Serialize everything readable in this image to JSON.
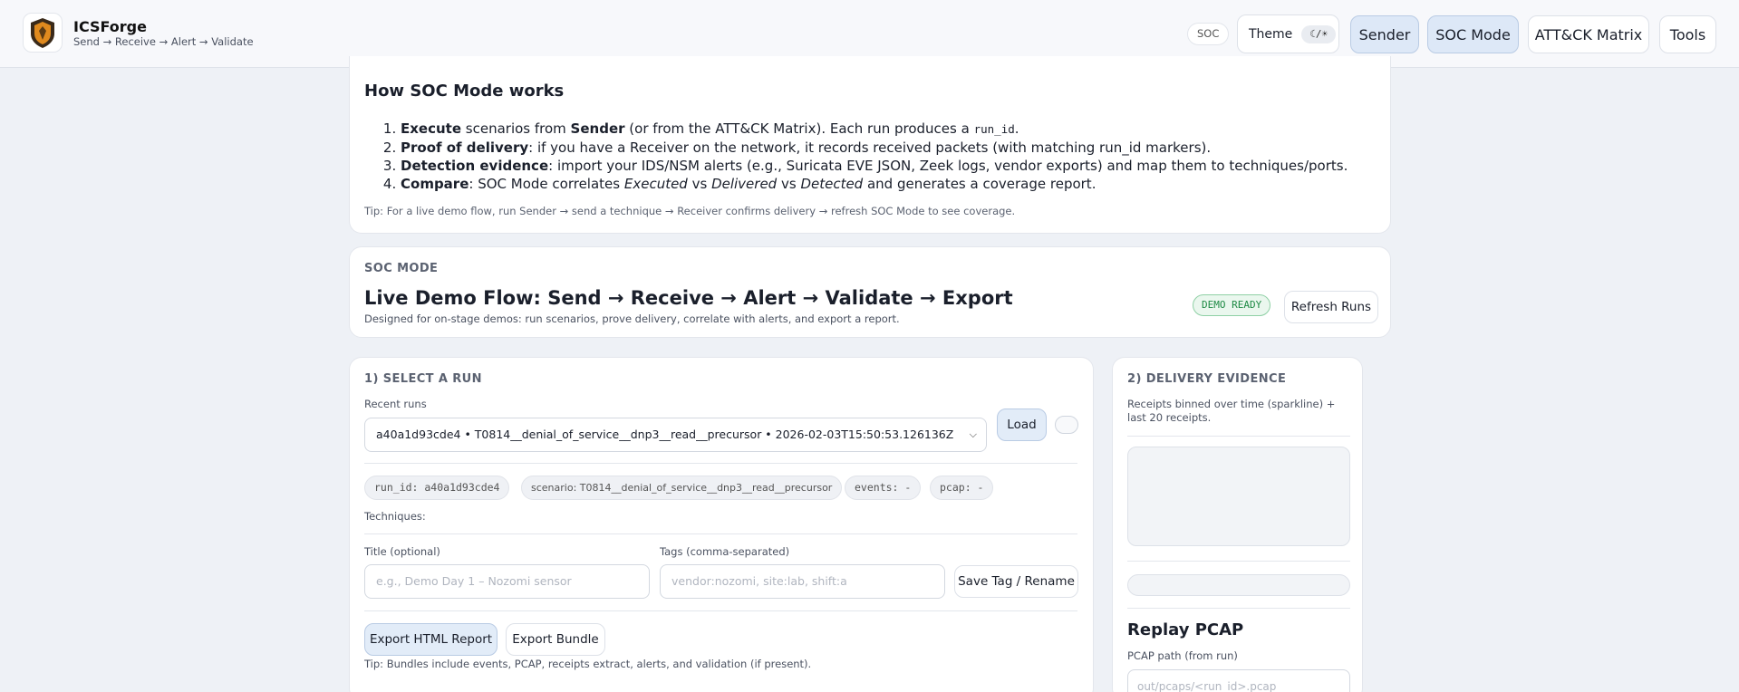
{
  "brand": {
    "name": "ICSForge",
    "tagline": "Send → Receive → Alert → Validate",
    "logo_text": "ICSforge"
  },
  "nav": {
    "soc_pill": "SOC",
    "theme_label": "Theme",
    "theme_toggle": "☾/☀",
    "items": [
      "Sender",
      "SOC Mode",
      "ATT&CK Matrix",
      "Tools"
    ],
    "active": [
      "Sender",
      "SOC Mode"
    ]
  },
  "how": {
    "title": "How SOC Mode works",
    "steps": [
      {
        "bold": "Execute",
        "text1": " scenarios from ",
        "bold2": "Sender",
        "text2": " (or from the ATT&CK Matrix). Each run produces a ",
        "code": "run_id",
        "text3": "."
      },
      {
        "bold": "Proof of delivery",
        "text1": ": if you have a Receiver on the network, it records received packets (with matching run_id markers)."
      },
      {
        "bold": "Detection evidence",
        "text1": ": import your IDS/NSM alerts (e.g., Suricata EVE JSON, Zeek logs, vendor exports) and map them to techniques/ports."
      },
      {
        "bold": "Compare",
        "text1": ": SOC Mode correlates ",
        "em1": "Executed",
        "text2": " vs ",
        "em2": "Delivered",
        "text3": " vs ",
        "em3": "Detected",
        "text4": " and generates a coverage report."
      }
    ],
    "tip": "Tip: For a live demo flow, run Sender → send a technique → Receiver confirms delivery → refresh SOC Mode to see coverage."
  },
  "soc": {
    "eyebrow": "SOC MODE",
    "title": "Live Demo Flow: Send → Receive → Alert → Validate → Export",
    "subtitle": "Designed for on-stage demos: run scenarios, prove delivery, correlate with alerts, and export a report.",
    "badge": "DEMO READY",
    "refresh_label": "Refresh Runs"
  },
  "run": {
    "heading": "1) SELECT A RUN",
    "recent_label": "Recent runs",
    "selected": "a40a1d93cde4 • T0814__denial_of_service__dnp3__read__precursor • 2026-02-03T15:50:53.126136Z",
    "load_label": "Load",
    "chips": {
      "run_id": "run_id: a40a1d93cde4",
      "scenario": "scenario: T0814__denial_of_service__dnp3__read__precursor",
      "events": "events: -",
      "pcap": "pcap: -"
    },
    "techniques_label": "Techniques:",
    "title_label": "Title (optional)",
    "title_placeholder": "e.g., Demo Day 1 – Nozomi sensor",
    "tags_label": "Tags (comma-separated)",
    "tags_placeholder": "vendor:nozomi, site:lab, shift:a",
    "save_label": "Save Tag / Rename",
    "export_html_label": "Export HTML Report",
    "export_bundle_label": "Export Bundle",
    "tip": "Tip: Bundles include events, PCAP, receipts extract, alerts, and validation (if present)."
  },
  "delivery": {
    "heading": "2) DELIVERY EVIDENCE",
    "subtitle": "Receipts binned over time (sparkline) + last 20 receipts.",
    "replay_title": "Replay PCAP",
    "pcap_label": "PCAP path (from run)",
    "pcap_placeholder": "out/pcaps/<run_id>.pcap"
  }
}
